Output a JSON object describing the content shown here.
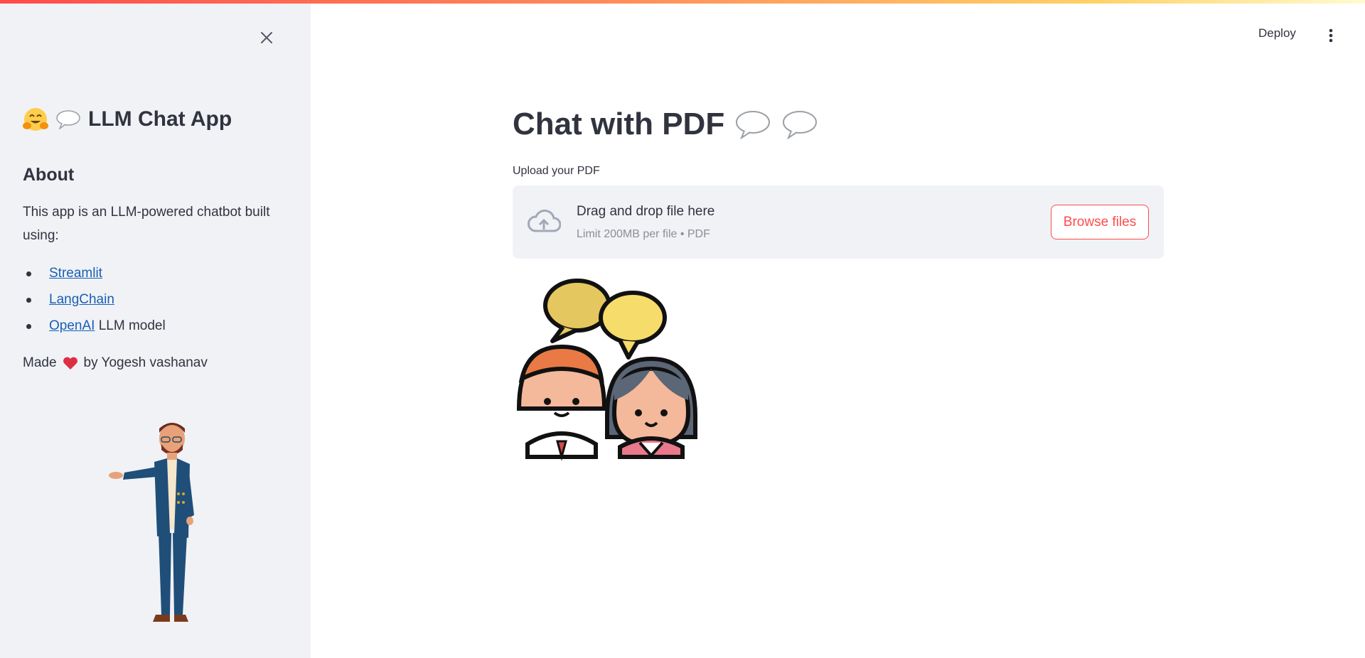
{
  "sidebar": {
    "title": "LLM Chat App",
    "about_heading": "About",
    "description": "This app is an LLM-powered chatbot built using:",
    "links": [
      {
        "label": "Streamlit",
        "suffix": ""
      },
      {
        "label": "LangChain",
        "suffix": ""
      },
      {
        "label": "OpenAI",
        "suffix": " LLM model"
      }
    ],
    "made_prefix": "Made",
    "made_suffix": "by Yogesh vashanav"
  },
  "header": {
    "deploy_label": "Deploy"
  },
  "main": {
    "title": "Chat with PDF",
    "upload_label": "Upload your PDF",
    "dropzone_text": "Drag and drop file here",
    "dropzone_limit": "Limit 200MB per file • PDF",
    "browse_label": "Browse files"
  },
  "colors": {
    "accent": "#ff4b4b",
    "link": "#1a5fb4",
    "sidebar_bg": "#f0f2f6"
  },
  "icons": [
    "close-icon",
    "hugging-face-emoji",
    "speech-bubble-icon",
    "heart-icon",
    "cloud-upload-icon",
    "kebab-menu-icon"
  ]
}
